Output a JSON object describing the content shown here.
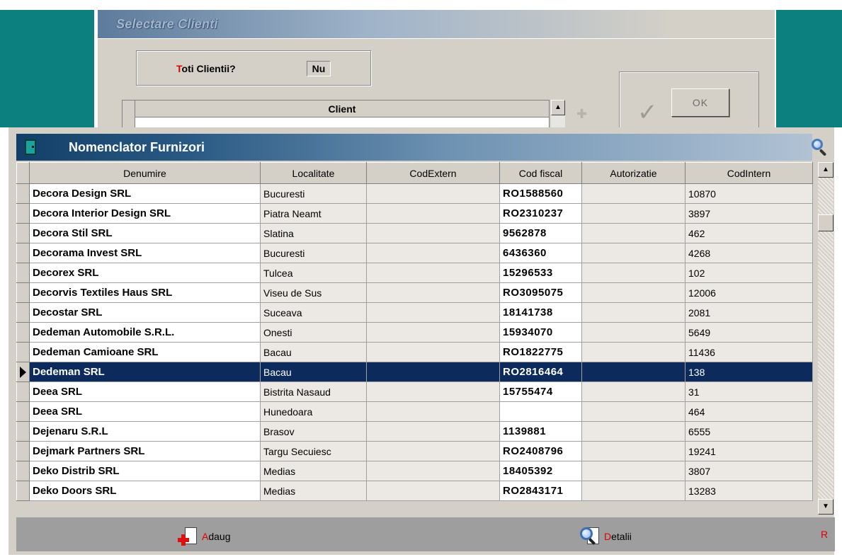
{
  "back_window": {
    "title": "Selectare Clienti",
    "toti_label_first": "T",
    "toti_label_rest": "oti Clientii?",
    "toti_value": "Nu",
    "client_header": "Client",
    "ok_label": "OK"
  },
  "main_window": {
    "title": "Nomenclator Furnizori",
    "columns": [
      "Denumire",
      "Localitate",
      "CodExtern",
      "Cod fiscal",
      "Autorizatie",
      "CodIntern"
    ],
    "rows": [
      {
        "denumire": "Decora Design SRL",
        "localitate": "Bucuresti",
        "cod_extern": "",
        "cod_fiscal": "RO1588560",
        "autorizatie": "",
        "cod_intern": "10870"
      },
      {
        "denumire": "Decora Interior Design SRL",
        "localitate": "Piatra Neamt",
        "cod_extern": "",
        "cod_fiscal": "RO2310237",
        "autorizatie": "",
        "cod_intern": "3897"
      },
      {
        "denumire": "Decora Stil SRL",
        "localitate": "Slatina",
        "cod_extern": "",
        "cod_fiscal": "9562878",
        "autorizatie": "",
        "cod_intern": "462"
      },
      {
        "denumire": "Decorama Invest SRL",
        "localitate": "Bucuresti",
        "cod_extern": "",
        "cod_fiscal": "6436360",
        "autorizatie": "",
        "cod_intern": "4268"
      },
      {
        "denumire": "Decorex SRL",
        "localitate": "Tulcea",
        "cod_extern": "",
        "cod_fiscal": "15296533",
        "autorizatie": "",
        "cod_intern": "102"
      },
      {
        "denumire": "Decorvis Textiles Haus SRL",
        "localitate": "Viseu de Sus",
        "cod_extern": "",
        "cod_fiscal": "RO3095075",
        "autorizatie": "",
        "cod_intern": "12006"
      },
      {
        "denumire": "Decostar SRL",
        "localitate": "Suceava",
        "cod_extern": "",
        "cod_fiscal": "18141738",
        "autorizatie": "",
        "cod_intern": "2081"
      },
      {
        "denumire": "Dedeman Automobile S.R.L.",
        "localitate": "Onesti",
        "cod_extern": "",
        "cod_fiscal": "15934070",
        "autorizatie": "",
        "cod_intern": "5649"
      },
      {
        "denumire": "Dedeman Camioane SRL",
        "localitate": "Bacau",
        "cod_extern": "",
        "cod_fiscal": "RO1822775",
        "autorizatie": "",
        "cod_intern": "11436"
      },
      {
        "denumire": "Dedeman SRL",
        "localitate": "Bacau",
        "cod_extern": "",
        "cod_fiscal": "RO2816464",
        "autorizatie": "",
        "cod_intern": "138"
      },
      {
        "denumire": "Deea SRL",
        "localitate": "Bistrita Nasaud",
        "cod_extern": "",
        "cod_fiscal": "15755474",
        "autorizatie": "",
        "cod_intern": "31"
      },
      {
        "denumire": "Deea SRL",
        "localitate": "Hunedoara",
        "cod_extern": "",
        "cod_fiscal": "",
        "autorizatie": "",
        "cod_intern": "464"
      },
      {
        "denumire": "Dejenaru S.R.L",
        "localitate": "Brasov",
        "cod_extern": "",
        "cod_fiscal": "1139881",
        "autorizatie": "",
        "cod_intern": "6555"
      },
      {
        "denumire": "Dejmark Partners SRL",
        "localitate": "Targu Secuiesc",
        "cod_extern": "",
        "cod_fiscal": "RO2408796",
        "autorizatie": "",
        "cod_intern": "19241"
      },
      {
        "denumire": "Deko Distrib SRL",
        "localitate": "Medias",
        "cod_extern": "",
        "cod_fiscal": "18405392",
        "autorizatie": "",
        "cod_intern": "3807"
      },
      {
        "denumire": "Deko Doors SRL",
        "localitate": "Medias",
        "cod_extern": "",
        "cod_fiscal": "RO2843171",
        "autorizatie": "",
        "cod_intern": "13283"
      }
    ],
    "selected_row_index": 9
  },
  "bottom_bar": {
    "adaug_first": "A",
    "adaug_rest": "daug",
    "detalii_first": "D",
    "detalii_rest": "etalii",
    "r_label": "R"
  },
  "colors": {
    "teal_background": "#0b807e",
    "selection": "#0c2b5c",
    "accent_red": "#e00000"
  },
  "icons": [
    "door-icon",
    "search-icon",
    "add-document-icon",
    "details-magnifier-icon",
    "check-icon",
    "plus-icon"
  ]
}
